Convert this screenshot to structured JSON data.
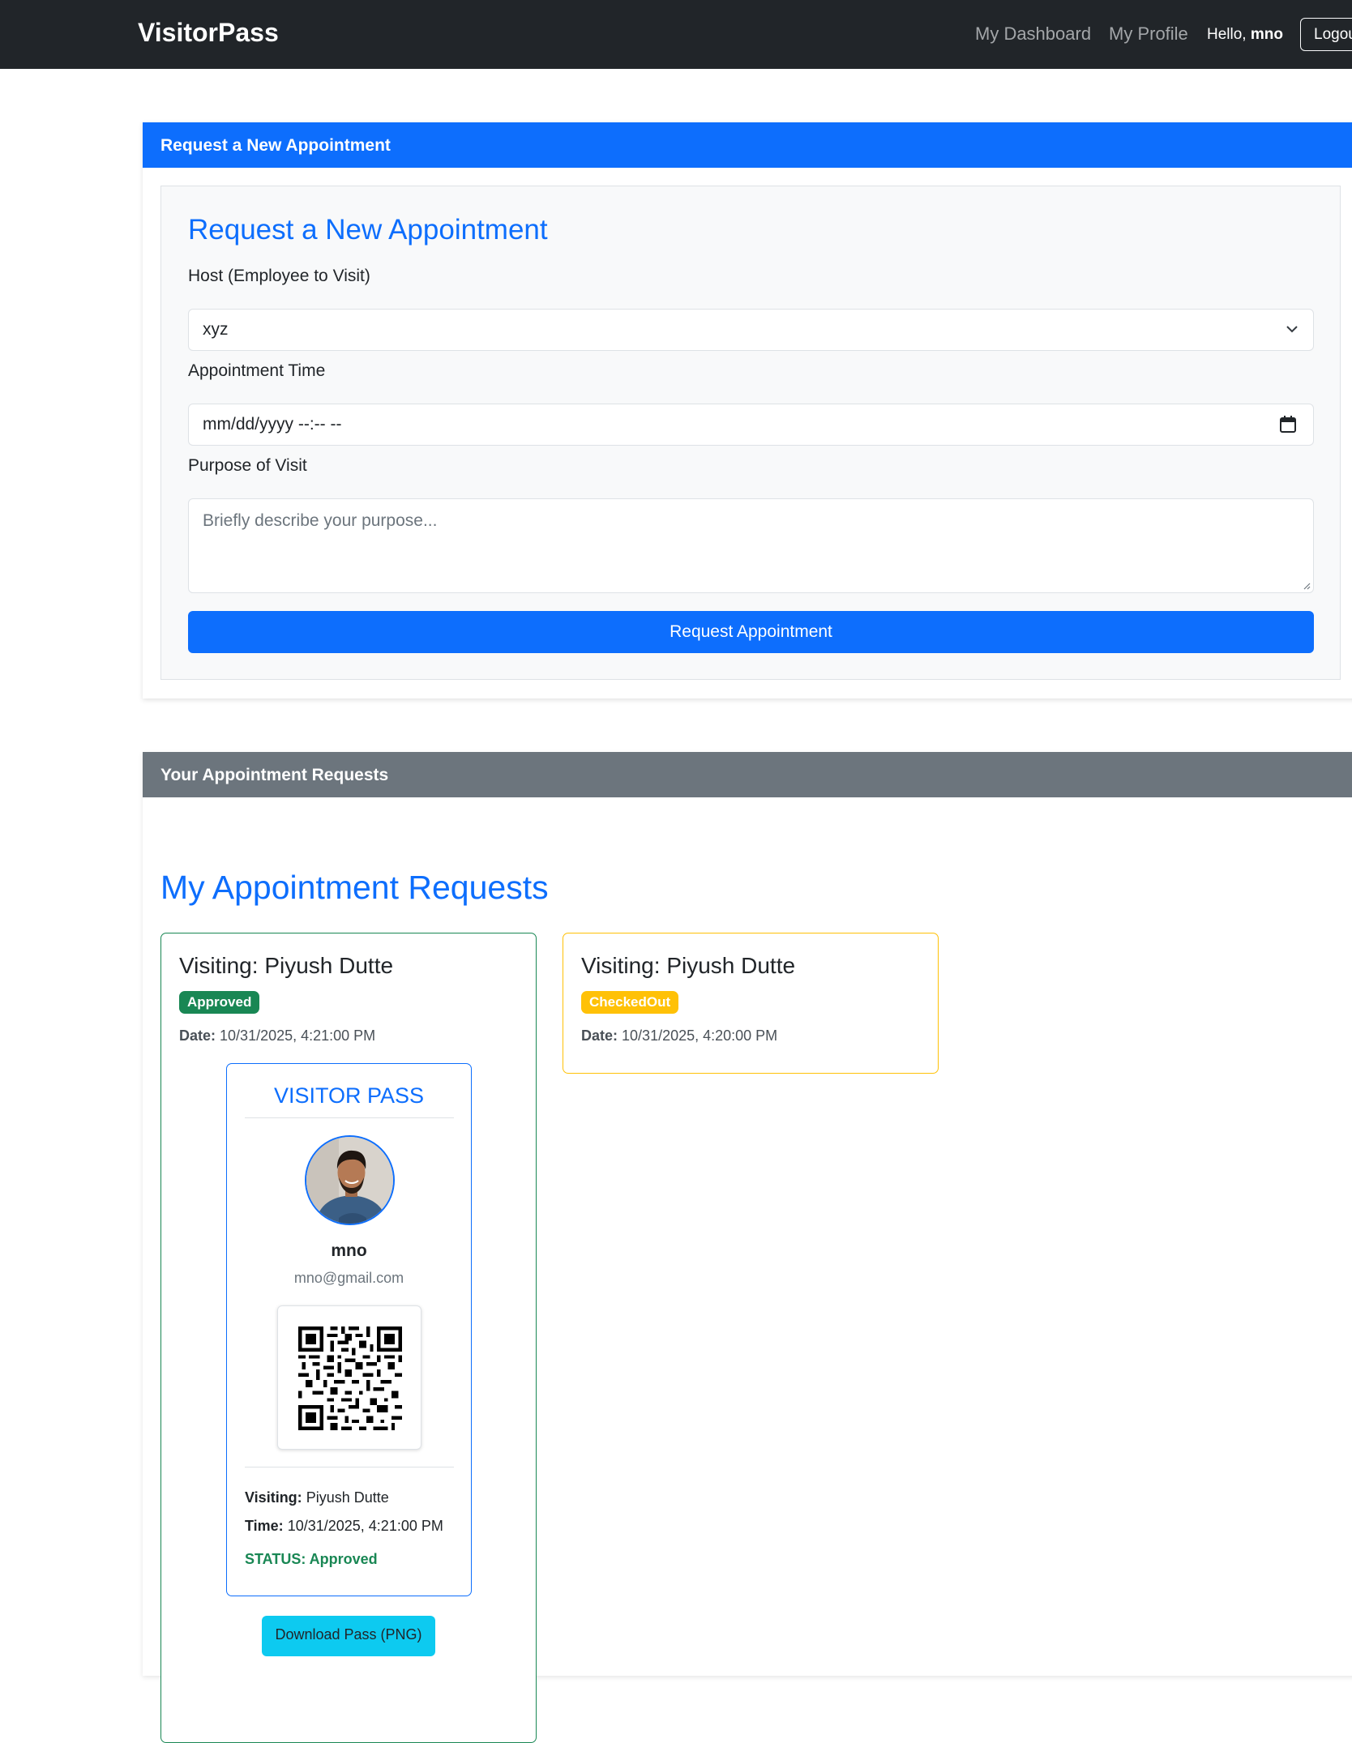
{
  "navbar": {
    "brand": "VisitorPass",
    "links": [
      {
        "label": "My Dashboard"
      },
      {
        "label": "My Profile"
      }
    ],
    "greeting": "Hello,",
    "username": "mno",
    "logout_label": "Logout"
  },
  "request_card": {
    "header": "Request a New Appointment",
    "form_title": "Request a New Appointment",
    "host_label": "Host (Employee to Visit)",
    "host_value": "xyz",
    "time_label": "Appointment Time",
    "time_placeholder": "mm/dd/yyyy --:-- --",
    "purpose_label": "Purpose of Visit",
    "purpose_placeholder": "Briefly describe your purpose...",
    "submit_label": "Request Appointment"
  },
  "requests_card": {
    "header": "Your Appointment Requests",
    "title": "My Appointment Requests",
    "date_label": "Date:",
    "appointments": [
      {
        "title": "Visiting: Piyush Dutte",
        "status": "Approved",
        "date": "10/31/2025, 4:21:00 PM",
        "status_color": "#198754"
      },
      {
        "title": "Visiting: Piyush Dutte",
        "status": "CheckedOut",
        "date": "10/31/2025, 4:20:00 PM",
        "status_color": "#ffc107"
      }
    ]
  },
  "visitor_pass": {
    "title": "VISITOR PASS",
    "name": "mno",
    "email": "mno@gmail.com",
    "visiting_label": "Visiting:",
    "visiting_value": "Piyush Dutte",
    "time_label": "Time:",
    "time_value": "10/31/2025, 4:21:00 PM",
    "status_text": "STATUS: Approved",
    "download_label": "Download Pass (PNG)"
  },
  "colors": {
    "primary": "#0d6efd",
    "navbar": "#212529",
    "secondary": "#6c757d",
    "success": "#198754",
    "warning": "#ffc107",
    "info": "#0dcaf0"
  }
}
